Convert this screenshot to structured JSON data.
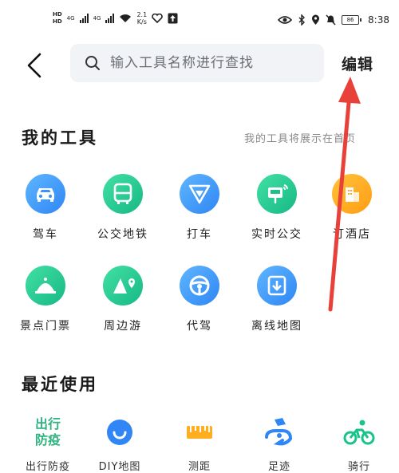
{
  "status_bar": {
    "hd1": "HD",
    "hd2": "HD",
    "net1": "4G",
    "net2": "4G",
    "speed_value": "2.1",
    "speed_unit": "K/s",
    "battery": "86",
    "time": "8:38"
  },
  "header": {
    "search_placeholder": "输入工具名称进行查找",
    "edit_label": "编辑"
  },
  "my_tools": {
    "title": "我的工具",
    "hint": "我的工具将展示在首页",
    "items": [
      {
        "label": "驾车",
        "icon": "car-icon",
        "color": "blue"
      },
      {
        "label": "公交地铁",
        "icon": "bus-icon",
        "color": "green"
      },
      {
        "label": "打车",
        "icon": "taxi-icon",
        "color": "blue"
      },
      {
        "label": "实时公交",
        "icon": "bus-stop-icon",
        "color": "green"
      },
      {
        "label": "订酒店",
        "icon": "hotel-icon",
        "color": "orange"
      },
      {
        "label": "景点门票",
        "icon": "scenic-icon",
        "color": "green"
      },
      {
        "label": "周边游",
        "icon": "mountain-icon",
        "color": "green"
      },
      {
        "label": "代驾",
        "icon": "steering-wheel-icon",
        "color": "blue"
      },
      {
        "label": "离线地图",
        "icon": "download-map-icon",
        "color": "blue"
      }
    ]
  },
  "recent": {
    "title": "最近使用",
    "items": [
      {
        "label": "出行防疫",
        "icon_line1": "出行",
        "icon_line2": "防疫",
        "icon": "travel-epidemic-icon"
      },
      {
        "label": "DIY地图",
        "icon": "diy-map-icon"
      },
      {
        "label": "测距",
        "icon": "ruler-icon"
      },
      {
        "label": "足迹",
        "icon": "footprint-icon"
      },
      {
        "label": "骑行",
        "icon": "cycling-icon"
      }
    ]
  },
  "colors": {
    "accent_blue": "#2f86f4",
    "accent_green": "#17b886",
    "accent_orange": "#ff9d12",
    "annotation_red": "#e8413a"
  }
}
